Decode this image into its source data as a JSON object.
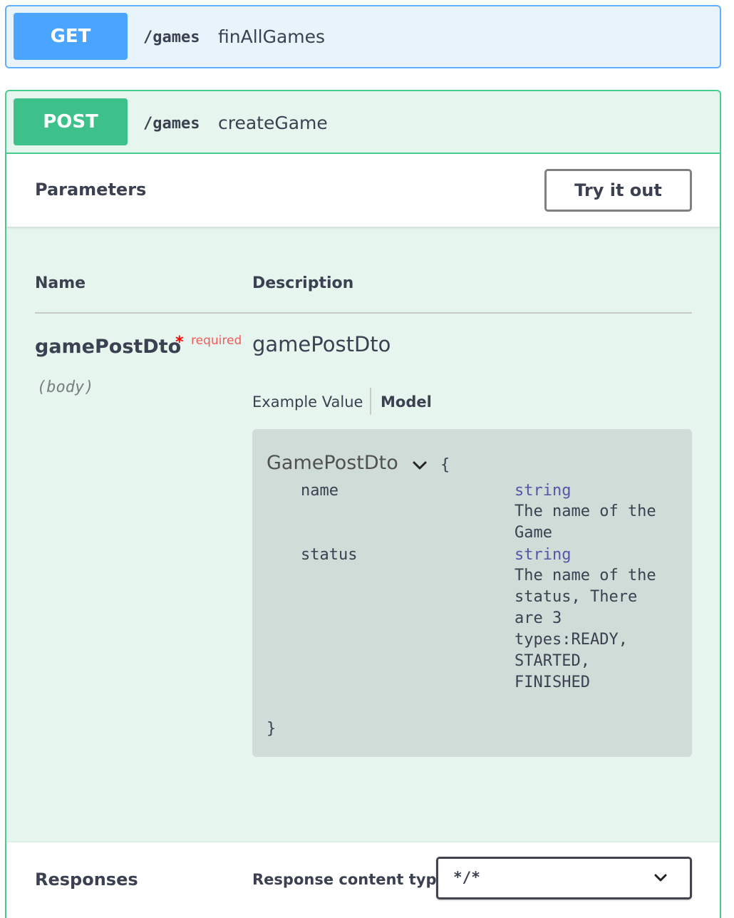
{
  "get_op": {
    "method": "GET",
    "path": "/games",
    "summary": "finAllGames"
  },
  "post_op": {
    "method": "POST",
    "path": "/games",
    "summary": "createGame",
    "parameters_title": "Parameters",
    "try_it_out_label": "Try it out",
    "columns": {
      "name": "Name",
      "description": "Description"
    },
    "param": {
      "name": "gamePostDto",
      "required_star": "*",
      "required_label": "required",
      "location": "(body)",
      "title": "gamePostDto"
    },
    "tabs": {
      "example": "Example Value",
      "model": "Model"
    },
    "model": {
      "name": "GamePostDto",
      "open_brace": "{",
      "close_brace": "}",
      "properties": [
        {
          "name": "name",
          "type": "string",
          "description": "The name of the\nGame"
        },
        {
          "name": "status",
          "type": "string",
          "description": "The name of the\nstatus, There\nare 3\ntypes:READY,\nSTARTED,\nFINISHED"
        }
      ]
    },
    "responses_title": "Responses",
    "response_content_type_label": "Response content type",
    "response_content_type_value": "*/*"
  },
  "colors": {
    "get": "#61affe",
    "post": "#49cc90",
    "required": "#ff0000",
    "type": "#5555aa"
  },
  "icons": [
    "chevron-down-icon"
  ]
}
